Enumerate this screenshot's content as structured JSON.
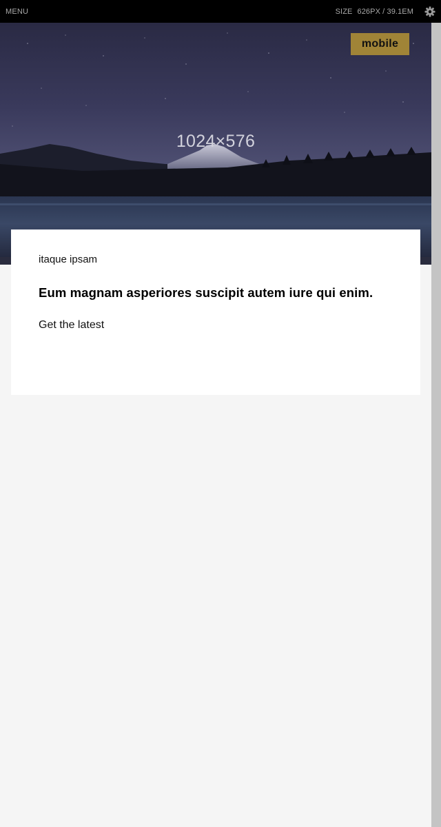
{
  "topbar": {
    "menu_label": "MENU",
    "size_label": "SIZE",
    "size_value": "626PX / 39.1EM",
    "settings_icon": "gear-icon"
  },
  "hero": {
    "placeholder_label": "1024×576",
    "badge_label": "mobile"
  },
  "card": {
    "eyebrow": "itaque ipsam",
    "headline": "Eum magnam asperiores suscipit autem iure qui enim.",
    "cta_label": "Get the latest"
  },
  "colors": {
    "topbar_bg": "#000000",
    "badge_bg": "#a08437",
    "page_bg": "#f5f5f5",
    "card_bg": "#ffffff",
    "scrollbar": "#c4c4c4"
  }
}
